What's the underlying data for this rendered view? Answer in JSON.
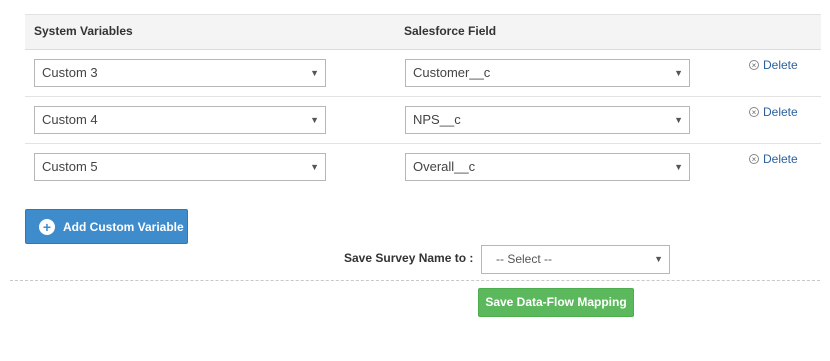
{
  "table": {
    "headers": {
      "system": "System Variables",
      "salesforce": "Salesforce Field"
    },
    "rows": [
      {
        "system": "Custom 3",
        "salesforce": "Customer__c",
        "delete_label": "Delete"
      },
      {
        "system": "Custom 4",
        "salesforce": "NPS__c",
        "delete_label": "Delete"
      },
      {
        "system": "Custom 5",
        "salesforce": "Overall__c",
        "delete_label": "Delete"
      }
    ]
  },
  "actions": {
    "add_custom_variable": "Add Custom Variable",
    "save_survey_name_label": "Save Survey Name to :",
    "save_survey_name_value": "-- Select --",
    "save_mapping": "Save Data-Flow Mapping"
  },
  "icons": {
    "delete": "x-circle-icon",
    "add": "plus-circle-icon",
    "caret": "chevron-down-icon"
  },
  "colors": {
    "primary_button": "#3f8ccd",
    "success_button": "#5cb85c",
    "link": "#2b5f9e"
  }
}
